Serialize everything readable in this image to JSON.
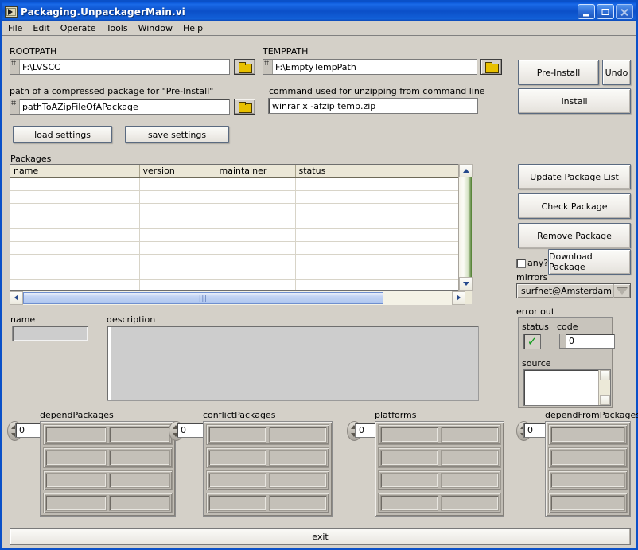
{
  "window": {
    "title": "Packaging.UnpackagerMain.vi",
    "icon": "labview-vi-icon",
    "buttons": {
      "minimize": "minimize-button",
      "maximize": "maximize-button",
      "close": "close-button"
    }
  },
  "menu": {
    "items": [
      {
        "label": "File"
      },
      {
        "label": "Edit"
      },
      {
        "label": "Operate"
      },
      {
        "label": "Tools"
      },
      {
        "label": "Window"
      },
      {
        "label": "Help"
      }
    ]
  },
  "paths": {
    "rootpath_label": "ROOTPATH",
    "rootpath_value": "F:\\LVSCC",
    "temppath_label": "TEMPPATH",
    "temppath_value": "F:\\EmptyTempPath",
    "package_label": "path of a compressed package for \"Pre-Install\"",
    "package_value": "pathToAZipFileOfAPackage",
    "command_label": "command used for unzipping from command line",
    "command_value": "winrar x -afzip temp.zip"
  },
  "settings": {
    "load_label": "load settings",
    "save_label": "save settings"
  },
  "install": {
    "pre_install_label": "Pre-Install",
    "undo_label": "Undo",
    "install_label": "Install"
  },
  "packages": {
    "section_label": "Packages",
    "columns": [
      "name",
      "version",
      "maintainer",
      "status"
    ],
    "rows": [],
    "empty_row_count": 9
  },
  "package_actions": {
    "update_label": "Update Package List",
    "check_label": "Check Package",
    "remove_label": "Remove Package",
    "download_label": "Download Package",
    "any_label": "any?",
    "any_checked": false,
    "mirrors_label": "mirrors",
    "mirrors_value": "surfnet@Amsterdam"
  },
  "details": {
    "name_label": "name",
    "name_value": "",
    "description_label": "description",
    "description_value": ""
  },
  "error_out": {
    "cluster_label": "error out",
    "status_label": "status",
    "status_value": "no-error",
    "code_label": "code",
    "code_value": "0",
    "source_label": "source",
    "source_value": ""
  },
  "arrays": [
    {
      "label": "dependPackages",
      "index": "0",
      "rows": 4,
      "cells_per_row": 2
    },
    {
      "label": "conflictPackages",
      "index": "0",
      "rows": 4,
      "cells_per_row": 2
    },
    {
      "label": "platforms",
      "index": "0",
      "rows": 4,
      "cells_per_row": 2
    },
    {
      "label": "dependFromPackages",
      "index": "0",
      "rows": 4,
      "cells_per_row": 1
    }
  ],
  "footer": {
    "exit_label": "exit"
  },
  "colors": {
    "title_blue": "#0a50c8",
    "panel_gray": "#d4d0c8",
    "header_beige": "#ebe7d7",
    "scroll_green": "#4a7a2a",
    "status_green": "#0c9c18",
    "folder_yellow": "#e8c000"
  }
}
